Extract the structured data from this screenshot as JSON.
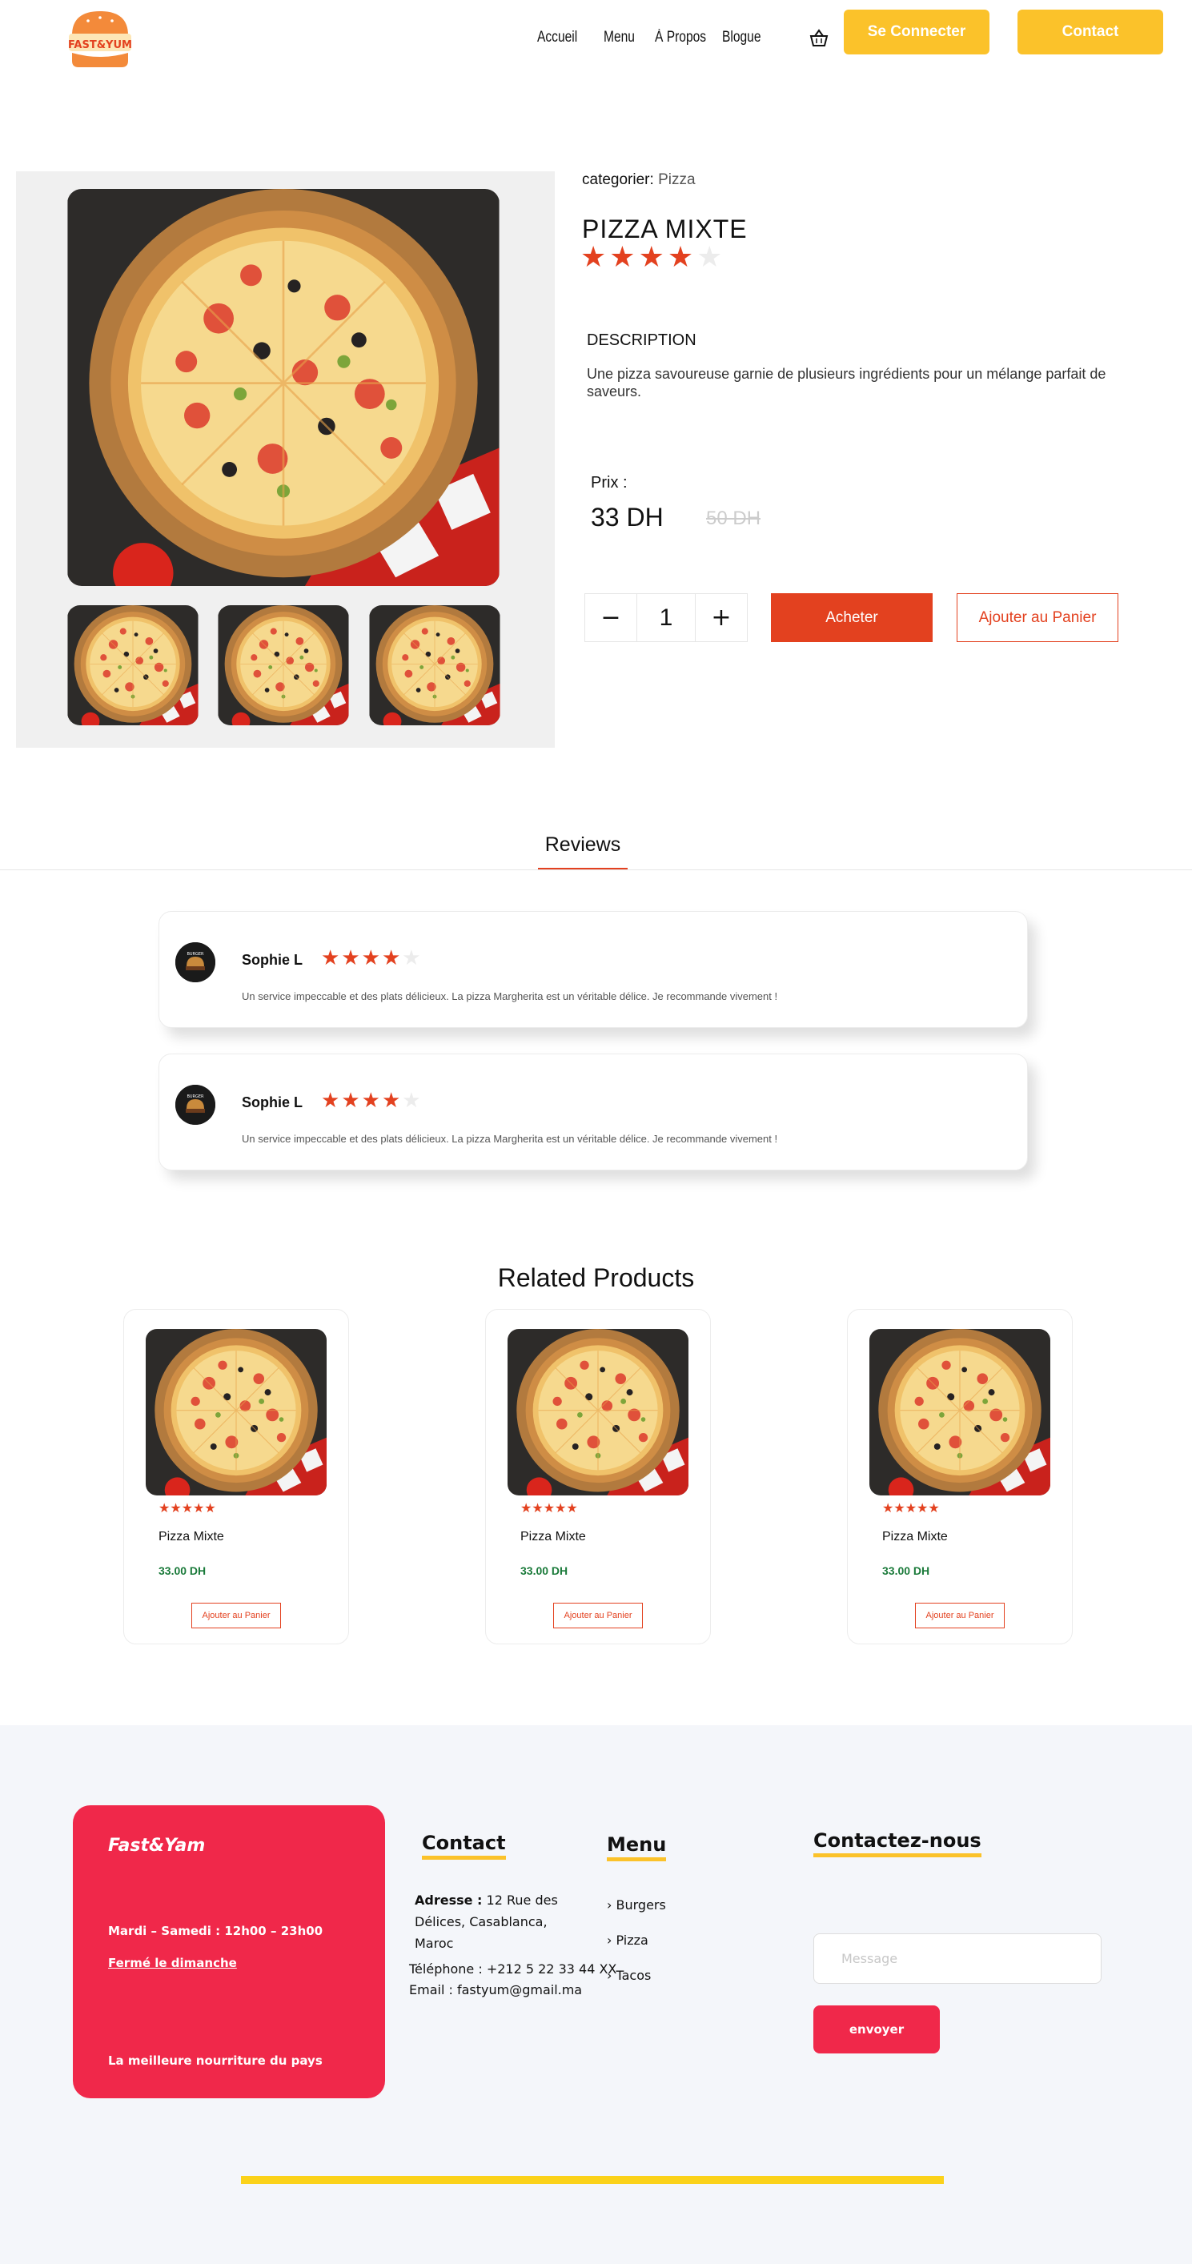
{
  "brand": {
    "logo_text": "FAST&YUM"
  },
  "nav": {
    "links": [
      "Accueil",
      "Menu",
      "À Propos",
      "Blogue"
    ],
    "login_label": "Se Connecter",
    "contact_label": "Contact",
    "basket_icon": "basket-icon"
  },
  "product": {
    "category_label": "categorier:",
    "category_value": "Pizza",
    "title": "PIZZA MIXTE",
    "rating": 4,
    "rating_max": 5,
    "description_title": "DESCRIPTION",
    "description": "Une pizza savoureuse garnie de plusieurs ingrédients pour un mélange parfait de saveurs.",
    "price_label": "Prix :",
    "price": "33 DH",
    "old_price": "50 DH",
    "quantity": "1",
    "minus": "−",
    "plus": "+",
    "buy_label": "Acheter",
    "add_to_cart_label": "Ajouter au Panier"
  },
  "reviews": {
    "tab_label": "Reviews",
    "items": [
      {
        "name": "Sophie L",
        "rating": 4,
        "text": "Un service impeccable et des plats délicieux. La pizza Margherita est un véritable délice. Je recommande vivement !"
      },
      {
        "name": "Sophie L",
        "rating": 4,
        "text": "Un service impeccable et des plats délicieux. La pizza Margherita est un véritable délice. Je recommande vivement !"
      }
    ]
  },
  "related": {
    "title": "Related Products",
    "items": [
      {
        "stars": "★★★★★",
        "name": "Pizza Mixte",
        "price": "33.00 DH",
        "button": "Ajouter au Panier"
      },
      {
        "stars": "★★★★★",
        "name": "Pizza Mixte",
        "price": "33.00 DH",
        "button": "Ajouter au Panier"
      },
      {
        "stars": "★★★★★",
        "name": "Pizza Mixte",
        "price": "33.00 DH",
        "button": "Ajouter au Panier"
      }
    ]
  },
  "footer": {
    "brand_name": "Fast&Yam",
    "hours": "Mardi – Samedi : 12h00 – 23h00",
    "closed": "Fermé le dimanche",
    "tagline": "La meilleure nourriture du pays",
    "contact_title": "Contact",
    "address_label": "Adresse :",
    "address_l1": "12 Rue des",
    "address_l2": "Délices, Casablanca,",
    "address_l3": "Maroc",
    "phone": "Téléphone : +212 5 22 33 44 XX",
    "email": "Email : fastyum@gmail.ma",
    "menu_title": "Menu",
    "menu_items": [
      "Burgers",
      "Pizza",
      "Tacos"
    ],
    "contact_us_title": "Contactez-nous",
    "message_placeholder": "Message",
    "send_label": "envoyer"
  },
  "colors": {
    "accent": "#e3411f",
    "yellow": "#fbc22a",
    "pink": "#f0284a",
    "price_green": "#1a7a3a"
  }
}
